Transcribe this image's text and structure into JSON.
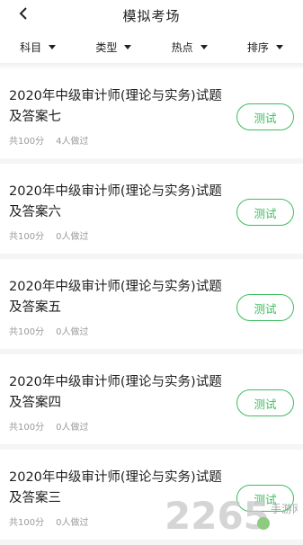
{
  "header": {
    "title": "模拟考场"
  },
  "filters": [
    {
      "label": "科目"
    },
    {
      "label": "类型"
    },
    {
      "label": "热点"
    },
    {
      "label": "排序"
    }
  ],
  "items": [
    {
      "title": "2020年中级审计师(理论与实务)试题及答案七",
      "total": "共100分",
      "done": "4人做过",
      "button": "测试"
    },
    {
      "title": "2020年中级审计师(理论与实务)试题及答案六",
      "total": "共100分",
      "done": "0人做过",
      "button": "测试"
    },
    {
      "title": "2020年中级审计师(理论与实务)试题及答案五",
      "total": "共100分",
      "done": "0人做过",
      "button": "测试"
    },
    {
      "title": "2020年中级审计师(理论与实务)试题及答案四",
      "total": "共100分",
      "done": "0人做过",
      "button": "测试"
    },
    {
      "title": "2020年中级审计师(理论与实务)试题及答案三",
      "total": "共100分",
      "done": "0人做过",
      "button": "测试"
    }
  ],
  "watermark": {
    "text": "2265",
    "sub": "手游网"
  },
  "colors": {
    "accent": "#3dbd5f"
  }
}
